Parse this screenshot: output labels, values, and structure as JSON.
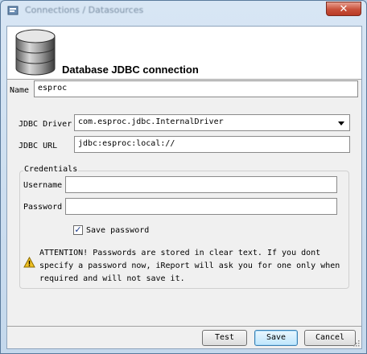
{
  "window": {
    "title": "Connections / Datasources",
    "close_glyph": "✕"
  },
  "header": {
    "title": "Database JDBC connection",
    "icon": "database-icon"
  },
  "form": {
    "name_label": "Name",
    "name_value": "esproc",
    "driver_label": "JDBC Driver",
    "driver_value": "com.esproc.jdbc.InternalDriver",
    "url_label": "JDBC URL",
    "url_value": "jdbc:esproc:local://"
  },
  "credentials": {
    "legend": "Credentials",
    "username_label": "Username",
    "username_value": "",
    "password_label": "Password",
    "password_value": "",
    "save_password_label": "Save password",
    "save_password_checked": true,
    "check_glyph": "✓"
  },
  "warning": {
    "icon": "warning-icon",
    "text": "ATTENTION! Passwords are stored in clear text. If you dont specify a password now, iReport will ask you for one only when required and will not save it."
  },
  "buttons": {
    "test": "Test",
    "save": "Save",
    "cancel": "Cancel"
  },
  "colors": {
    "accent": "#3c7fb1",
    "close": "#c8503a",
    "warning": "#f0c020"
  }
}
